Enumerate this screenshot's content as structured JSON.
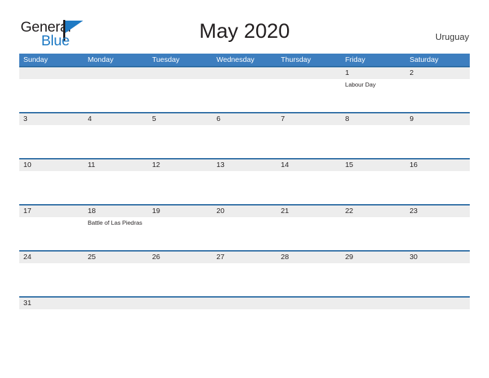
{
  "brand": {
    "word_one": "General",
    "word_two": "Blue",
    "flag_icon": "blue-flag-triangle-icon",
    "color_primary": "#1f7ac4",
    "color_text": "#231f20"
  },
  "header": {
    "title": "May 2020",
    "country": "Uruguay"
  },
  "calendar": {
    "header_bg": "#3d7ebf",
    "row_border": "#2e6da4",
    "strip_bg": "#ededed",
    "day_names": [
      "Sunday",
      "Monday",
      "Tuesday",
      "Wednesday",
      "Thursday",
      "Friday",
      "Saturday"
    ],
    "weeks": [
      [
        {
          "date": "",
          "events": []
        },
        {
          "date": "",
          "events": []
        },
        {
          "date": "",
          "events": []
        },
        {
          "date": "",
          "events": []
        },
        {
          "date": "",
          "events": []
        },
        {
          "date": "1",
          "events": [
            "Labour Day"
          ]
        },
        {
          "date": "2",
          "events": []
        }
      ],
      [
        {
          "date": "3",
          "events": []
        },
        {
          "date": "4",
          "events": []
        },
        {
          "date": "5",
          "events": []
        },
        {
          "date": "6",
          "events": []
        },
        {
          "date": "7",
          "events": []
        },
        {
          "date": "8",
          "events": []
        },
        {
          "date": "9",
          "events": []
        }
      ],
      [
        {
          "date": "10",
          "events": []
        },
        {
          "date": "11",
          "events": []
        },
        {
          "date": "12",
          "events": []
        },
        {
          "date": "13",
          "events": []
        },
        {
          "date": "14",
          "events": []
        },
        {
          "date": "15",
          "events": []
        },
        {
          "date": "16",
          "events": []
        }
      ],
      [
        {
          "date": "17",
          "events": []
        },
        {
          "date": "18",
          "events": [
            "Battle of Las Piedras"
          ]
        },
        {
          "date": "19",
          "events": []
        },
        {
          "date": "20",
          "events": []
        },
        {
          "date": "21",
          "events": []
        },
        {
          "date": "22",
          "events": []
        },
        {
          "date": "23",
          "events": []
        }
      ],
      [
        {
          "date": "24",
          "events": []
        },
        {
          "date": "25",
          "events": []
        },
        {
          "date": "26",
          "events": []
        },
        {
          "date": "27",
          "events": []
        },
        {
          "date": "28",
          "events": []
        },
        {
          "date": "29",
          "events": []
        },
        {
          "date": "30",
          "events": []
        }
      ],
      [
        {
          "date": "31",
          "events": []
        },
        {
          "date": "",
          "events": []
        },
        {
          "date": "",
          "events": []
        },
        {
          "date": "",
          "events": []
        },
        {
          "date": "",
          "events": []
        },
        {
          "date": "",
          "events": []
        },
        {
          "date": "",
          "events": []
        }
      ]
    ]
  }
}
